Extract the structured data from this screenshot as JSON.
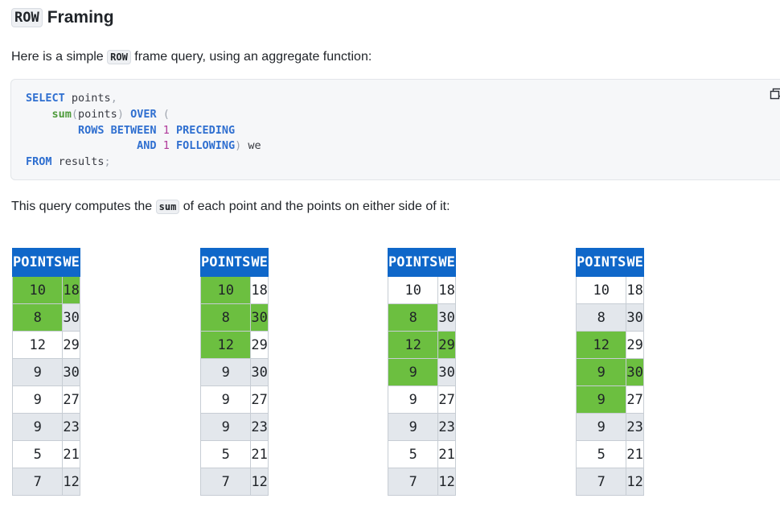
{
  "heading": {
    "code": "ROW",
    "text": "Framing"
  },
  "intro": {
    "before": "Here is a simple ",
    "code": "ROW",
    "after": " frame query, using an aggregate function:"
  },
  "codeblock": {
    "copy_icon": "copy-icon"
  },
  "explain": {
    "before": "This query computes the ",
    "code": "sum",
    "after": " of each point and the points on either side of it:"
  },
  "tables": {
    "headers": [
      "POINTS",
      "WE"
    ],
    "points": [
      "10",
      "8",
      "12",
      "9",
      "9",
      "9",
      "5",
      "7"
    ],
    "we": [
      "18",
      "30",
      "29",
      "30",
      "27",
      "23",
      "21",
      "12"
    ],
    "highlight_color": "#6cbf40",
    "header_color": "#0f67c9",
    "frames": [
      {
        "points_rows": [
          0,
          1
        ],
        "we_row": 0
      },
      {
        "points_rows": [
          0,
          1,
          2
        ],
        "we_row": 1
      },
      {
        "points_rows": [
          1,
          2,
          3
        ],
        "we_row": 2
      },
      {
        "points_rows": [
          2,
          3,
          4
        ],
        "we_row": 3
      }
    ]
  }
}
